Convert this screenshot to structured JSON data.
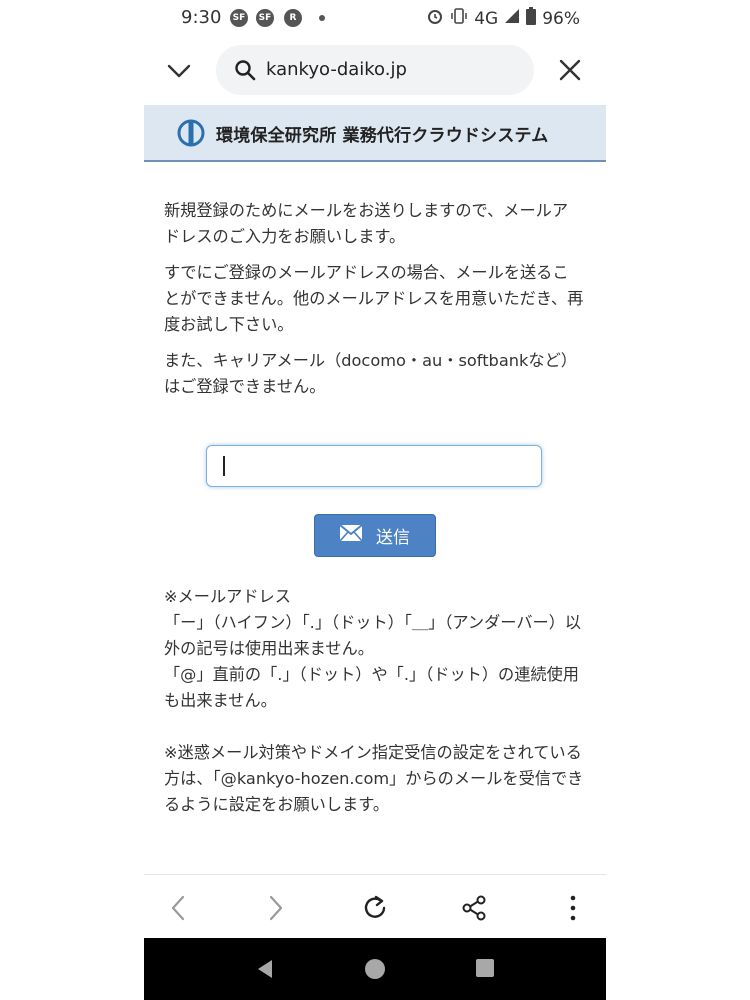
{
  "status_bar": {
    "time": "9:30",
    "network": "4G",
    "battery": "96%",
    "left_icons": [
      "SF",
      "SF",
      "R"
    ],
    "right_icons": [
      "alarm-icon",
      "vibrate-icon",
      "signal-icon",
      "battery-icon"
    ]
  },
  "browser": {
    "url": "kankyo-daiko.jp",
    "icons": [
      "chevron-down-icon",
      "search-icon",
      "close-icon"
    ]
  },
  "site_header": {
    "title": "環境保全研究所 業務代行クラウドシステム",
    "logo_color": "#2a6fb0",
    "background": "#dde7f1"
  },
  "intro": {
    "p1": "新規登録のためにメールをお送りしますので、メールアドレスのご入力をお願いします。",
    "p2": "すでにご登録のメールアドレスの場合、メールを送ることができません。他のメールアドレスを用意いただき、再度お試し下さい。",
    "p3": "また、キャリアメール（docomo・au・softbankなど）はご登録できません。"
  },
  "form": {
    "email_value": "",
    "send_label": "送信",
    "send_color": "#4d83c4"
  },
  "notes": {
    "line1": "※メールアドレス",
    "line2": "「ー」（ハイフン）「.」（ドット）「＿」（アンダーバー）以外の記号は使用出来ません。",
    "line3": "「@」直前の「.」（ドット）や「.」（ドット）の連続使用も出来ません。",
    "line4": "※迷惑メール対策やドメイン指定受信の設定をされている方は、「@kankyo-hozen.com」からのメールを受信できるように設定をお願いします。"
  },
  "toolbar": {
    "icons": [
      "back-icon",
      "forward-icon",
      "reload-icon",
      "share-icon",
      "more-icon"
    ]
  },
  "nav_bar": {
    "icons": [
      "nav-back-icon",
      "nav-home-icon",
      "nav-recents-icon"
    ]
  }
}
